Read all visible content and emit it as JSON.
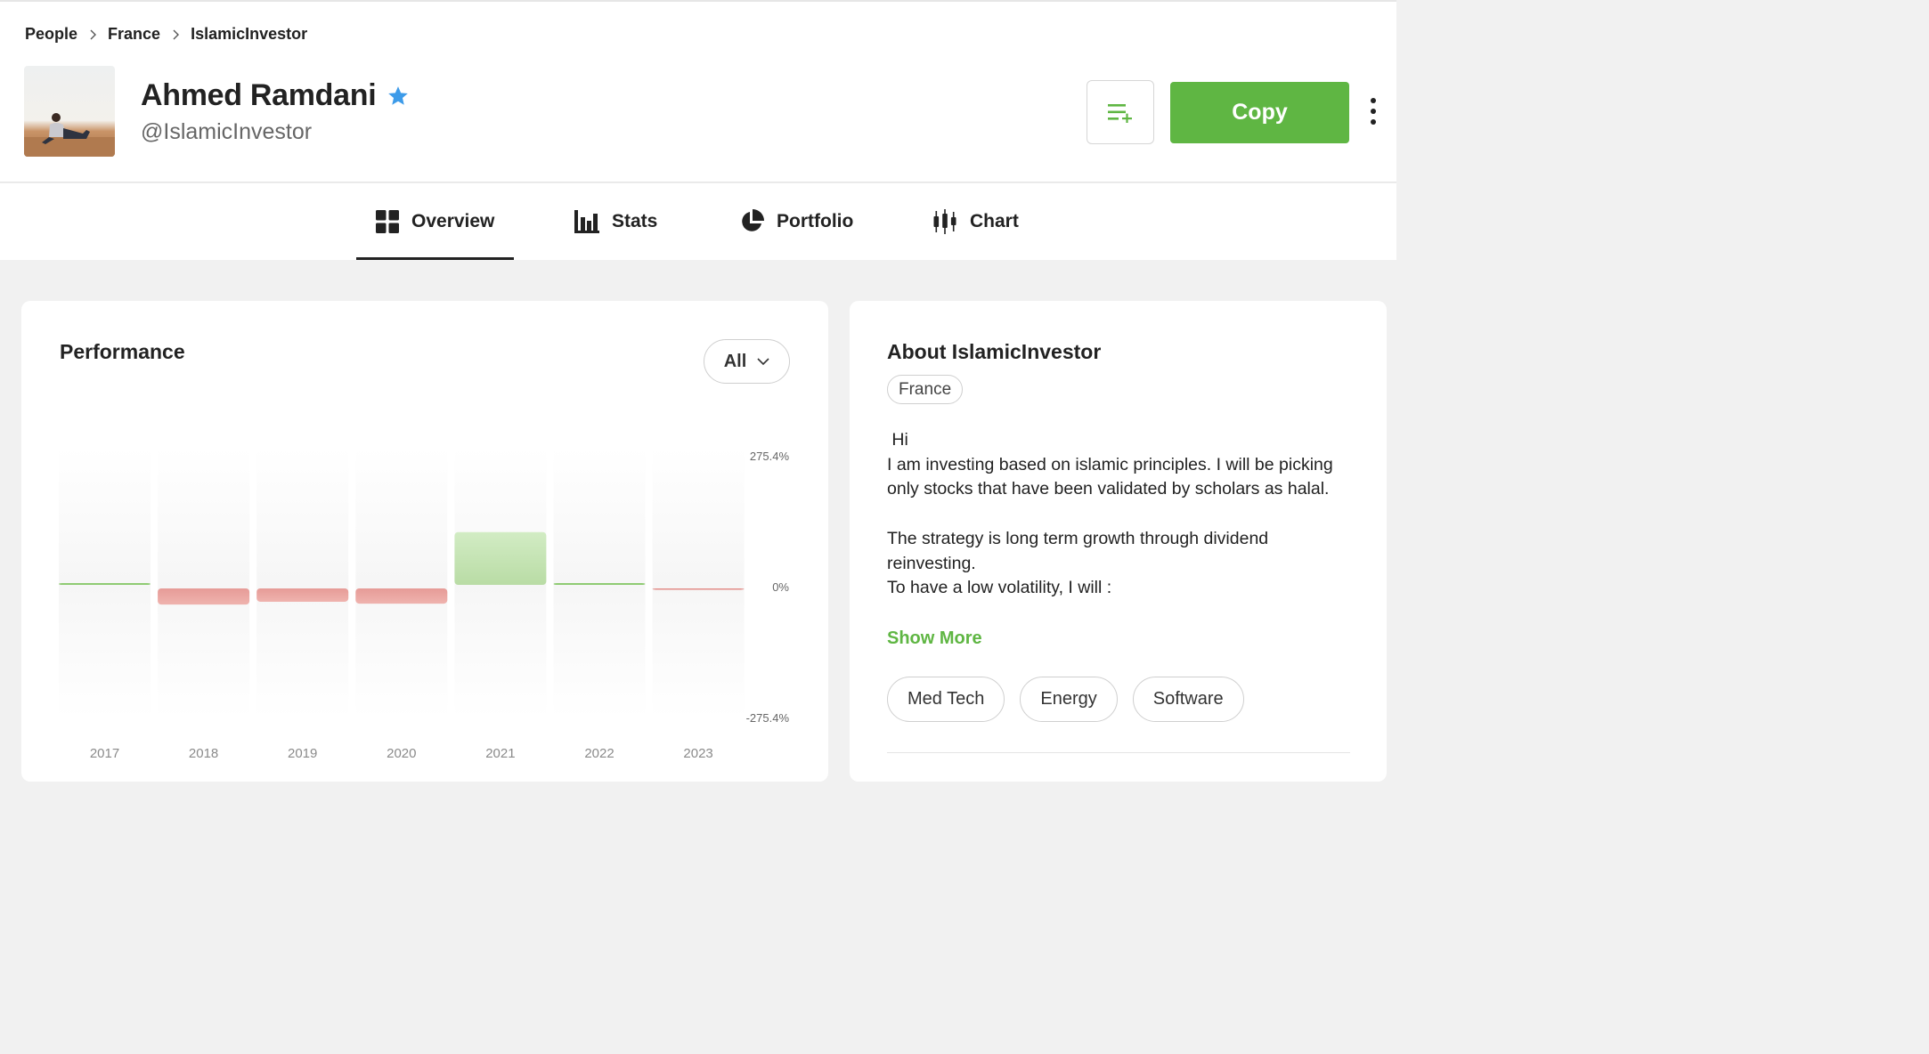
{
  "breadcrumb": [
    "People",
    "France",
    "IslamicInvestor"
  ],
  "profile": {
    "name": "Ahmed Ramdani",
    "handle": "@IslamicInvestor",
    "verified_icon": "star-icon",
    "verified_color": "#3d9be9"
  },
  "actions": {
    "watchlist_icon": "add-to-list-icon",
    "copy_label": "Copy",
    "more_icon": "more-vertical-icon"
  },
  "tabs": [
    {
      "label": "Overview",
      "icon": "grid-icon",
      "active": true
    },
    {
      "label": "Stats",
      "icon": "bar-chart-icon",
      "active": false
    },
    {
      "label": "Portfolio",
      "icon": "pie-chart-icon",
      "active": false
    },
    {
      "label": "Chart",
      "icon": "candlestick-icon",
      "active": false
    }
  ],
  "performance": {
    "title": "Performance",
    "range": "All"
  },
  "chart_data": {
    "type": "bar",
    "categories": [
      "2017",
      "2018",
      "2019",
      "2020",
      "2021",
      "2022",
      "2023"
    ],
    "values": [
      1.5,
      -34,
      -28,
      -32,
      104,
      0.5,
      -0.3
    ],
    "ylim": [
      -275.4,
      275.4
    ],
    "tick_labels": [
      "275.4%",
      "0%",
      "-275.4%"
    ],
    "positive_color": "#b9dca5",
    "negative_color": "#e69b97"
  },
  "about": {
    "title": "About IslamicInvestor",
    "country": "France",
    "bio": [
      " Hi",
      "I am investing based on islamic principles. I will be picking only stocks that have been validated by scholars as halal.",
      "",
      "The strategy is long term growth through dividend reinvesting.",
      "To have a low volatility, I will :"
    ],
    "show_more": "Show More",
    "tags": [
      "Med Tech",
      "Energy",
      "Software"
    ]
  },
  "colors": {
    "accent": "#5fb643",
    "text": "#222222"
  }
}
